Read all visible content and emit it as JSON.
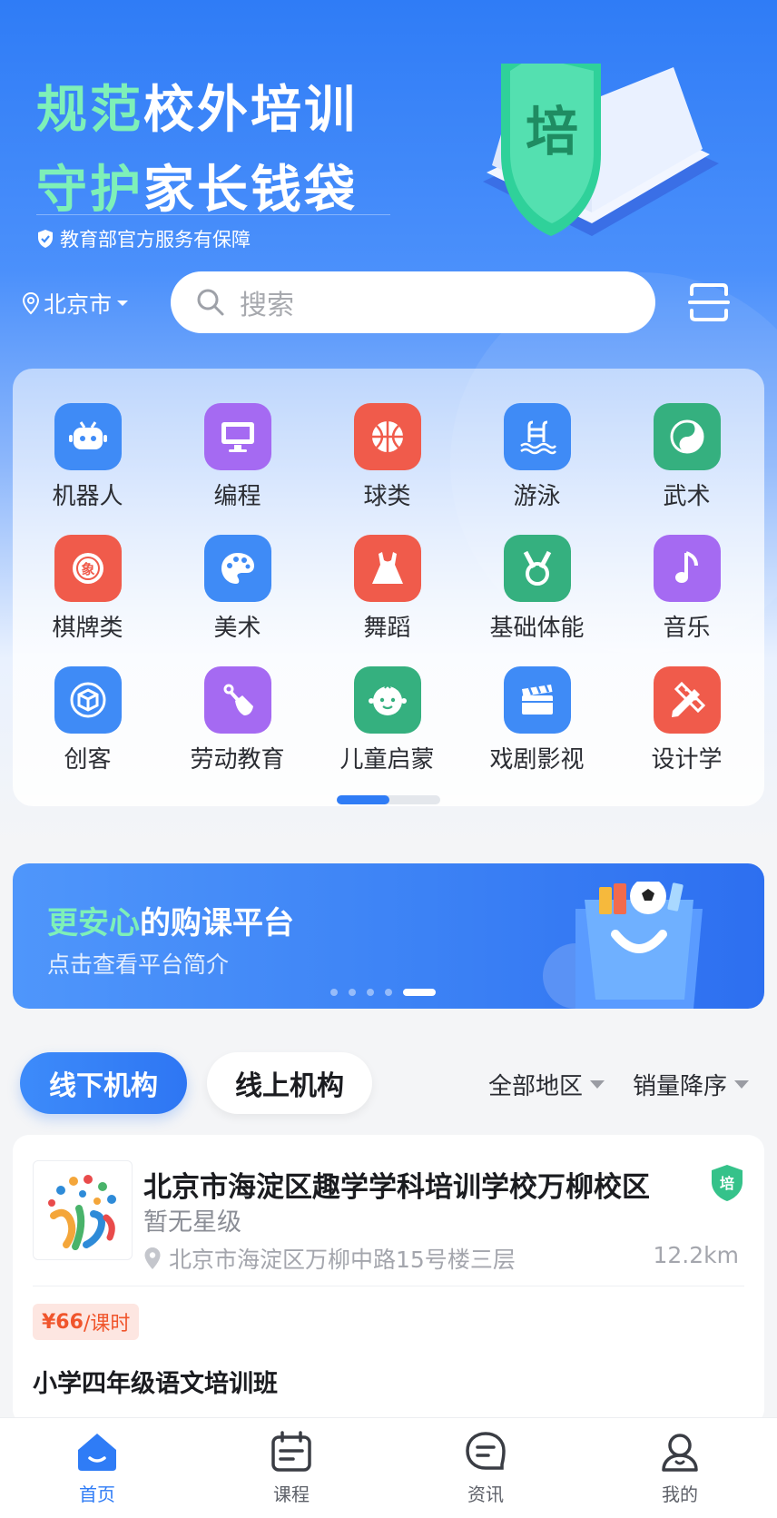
{
  "hero": {
    "slogan_line1_highlight": "规范",
    "slogan_line1_rest": "校外培训",
    "slogan_line2_highlight": "守护",
    "slogan_line2_rest": "家长钱袋",
    "guarantee": "教育部官方服务有保障",
    "badge_char": "培"
  },
  "header": {
    "city": "北京市",
    "search_placeholder": "搜索",
    "scan_icon": "scan-icon"
  },
  "categories": [
    {
      "label": "机器人",
      "icon": "robot-icon",
      "color": "#3f8bf6"
    },
    {
      "label": "编程",
      "icon": "monitor-icon",
      "color": "#a56af2"
    },
    {
      "label": "球类",
      "icon": "basketball-icon",
      "color": "#f05b4b"
    },
    {
      "label": "游泳",
      "icon": "pool-icon",
      "color": "#3f8bf6"
    },
    {
      "label": "武术",
      "icon": "yinyang-icon",
      "color": "#35b07f"
    },
    {
      "label": "棋牌类",
      "icon": "chess-icon",
      "color": "#f05b4b"
    },
    {
      "label": "美术",
      "icon": "palette-icon",
      "color": "#3f8bf6"
    },
    {
      "label": "舞蹈",
      "icon": "dress-icon",
      "color": "#f05b4b"
    },
    {
      "label": "基础体能",
      "icon": "medal-icon",
      "color": "#35b07f"
    },
    {
      "label": "音乐",
      "icon": "music-note-icon",
      "color": "#a56af2"
    },
    {
      "label": "创客",
      "icon": "cube-icon",
      "color": "#3f8bf6"
    },
    {
      "label": "劳动教育",
      "icon": "shovel-icon",
      "color": "#a56af2"
    },
    {
      "label": "儿童启蒙",
      "icon": "baby-face-icon",
      "color": "#35b07f"
    },
    {
      "label": "戏剧影视",
      "icon": "clapperboard-icon",
      "color": "#3f8bf6"
    },
    {
      "label": "设计学",
      "icon": "pencil-ruler-icon",
      "color": "#f05b4b"
    }
  ],
  "promo": {
    "title_highlight": "更安心",
    "title_rest": "的购课平台",
    "subtitle": "点击查看平台简介"
  },
  "filters": {
    "tab_offline": "线下机构",
    "tab_online": "线上机构",
    "region": "全部地区",
    "sort": "销量降序"
  },
  "listing": {
    "org_name": "北京市海淀区趣学学科培训学校万柳校区",
    "rating": "暂无星级",
    "address": "北京市海淀区万柳中路15号楼三层",
    "distance": "12.2km",
    "price": "¥66",
    "price_unit": "/课时",
    "course": "小学四年级语文培训班",
    "badge_char": "培"
  },
  "tabbar": [
    {
      "label": "首页",
      "icon": "home-icon",
      "active": true
    },
    {
      "label": "课程",
      "icon": "calendar-icon",
      "active": false
    },
    {
      "label": "资讯",
      "icon": "chat-icon",
      "active": false
    },
    {
      "label": "我的",
      "icon": "user-icon",
      "active": false
    }
  ],
  "colors": {
    "primary": "#2f7cf6",
    "highlight_green": "#7ef0b8",
    "price_red": "#f0552c"
  }
}
